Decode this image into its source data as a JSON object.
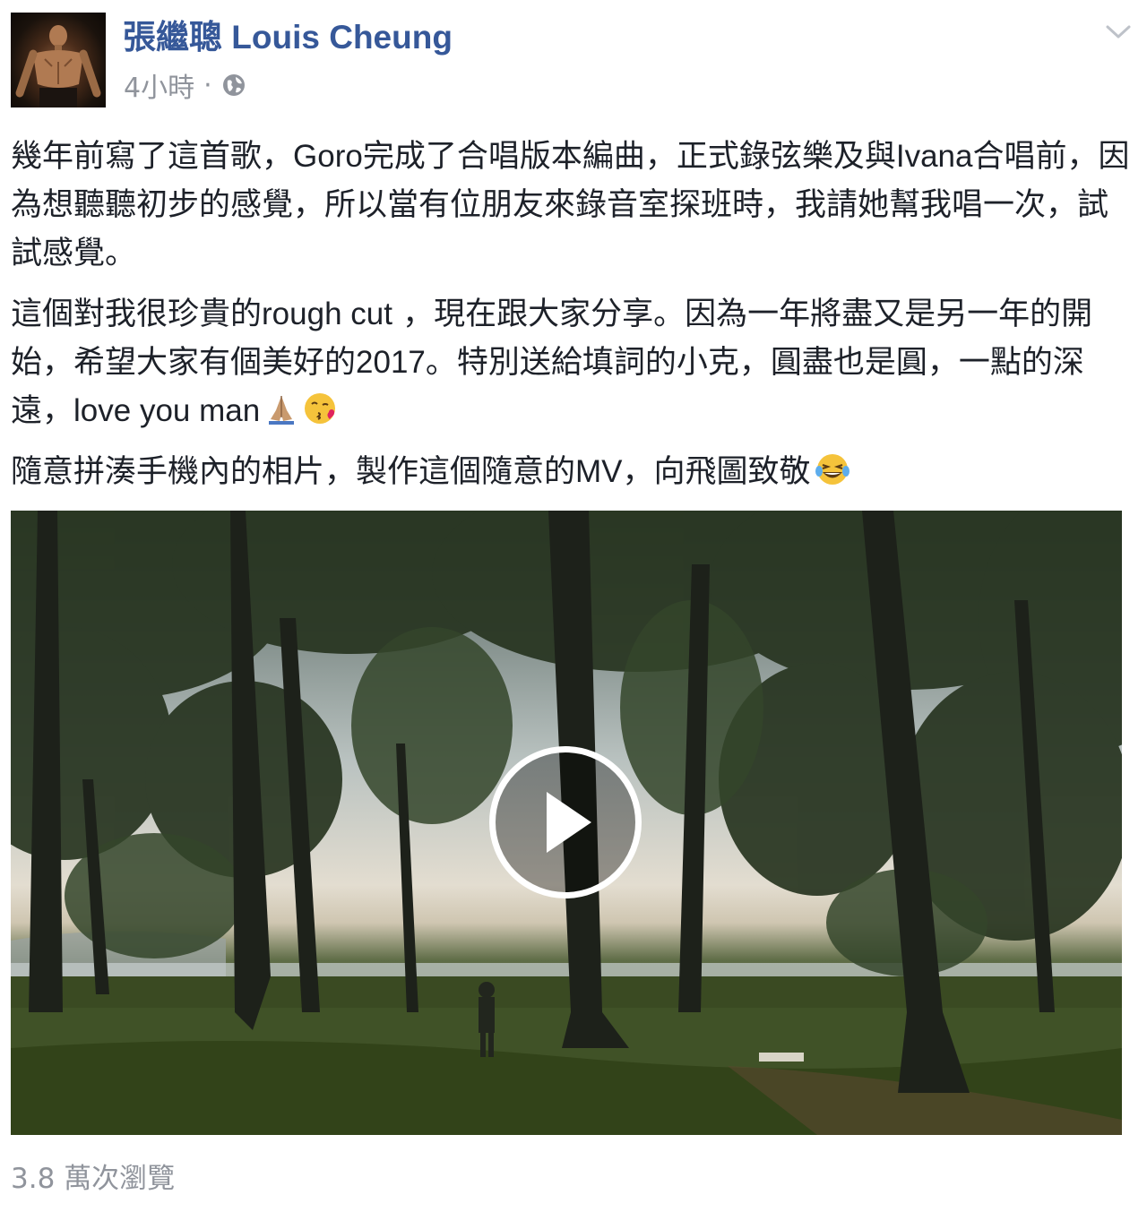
{
  "post": {
    "author": "張繼聰 Louis Cheung",
    "timestamp": "4小時",
    "separator": "·",
    "privacy_icon": "globe-icon",
    "menu_icon": "chevron-down-icon",
    "paragraphs": [
      [
        "幾年前寫了這首歌，",
        "Goro",
        "完成了合唱版本編曲，正式錄弦樂及與",
        "Ivana",
        "合唱前，因為想聽聽初步的感覺，所以當有位朋友來錄音室探班時，我請她幫我唱一次，試試感覺。"
      ],
      [
        "這個對我很珍貴的",
        "rough cut",
        " ，現在跟大家分享。因為一年將盡又是另一年的開始，希望大家有個美好的",
        "2017",
        "。特別送給填詞的小克，圓盡也是圓，一點的深遠，",
        "love you man"
      ],
      [
        "隨意拼湊手機內的相片，製作這個隨意的",
        "MV",
        "，向飛圖致敬"
      ]
    ],
    "emojis": [
      "folded-hands-emoji",
      "kissing-face-emoji",
      "laughing-tears-emoji"
    ],
    "video_play_icon": "play-icon",
    "views": "3.8 萬次瀏覽"
  },
  "colors": {
    "author_link": "#365899",
    "meta_text": "#90949c",
    "body_text": "#1d2129"
  }
}
